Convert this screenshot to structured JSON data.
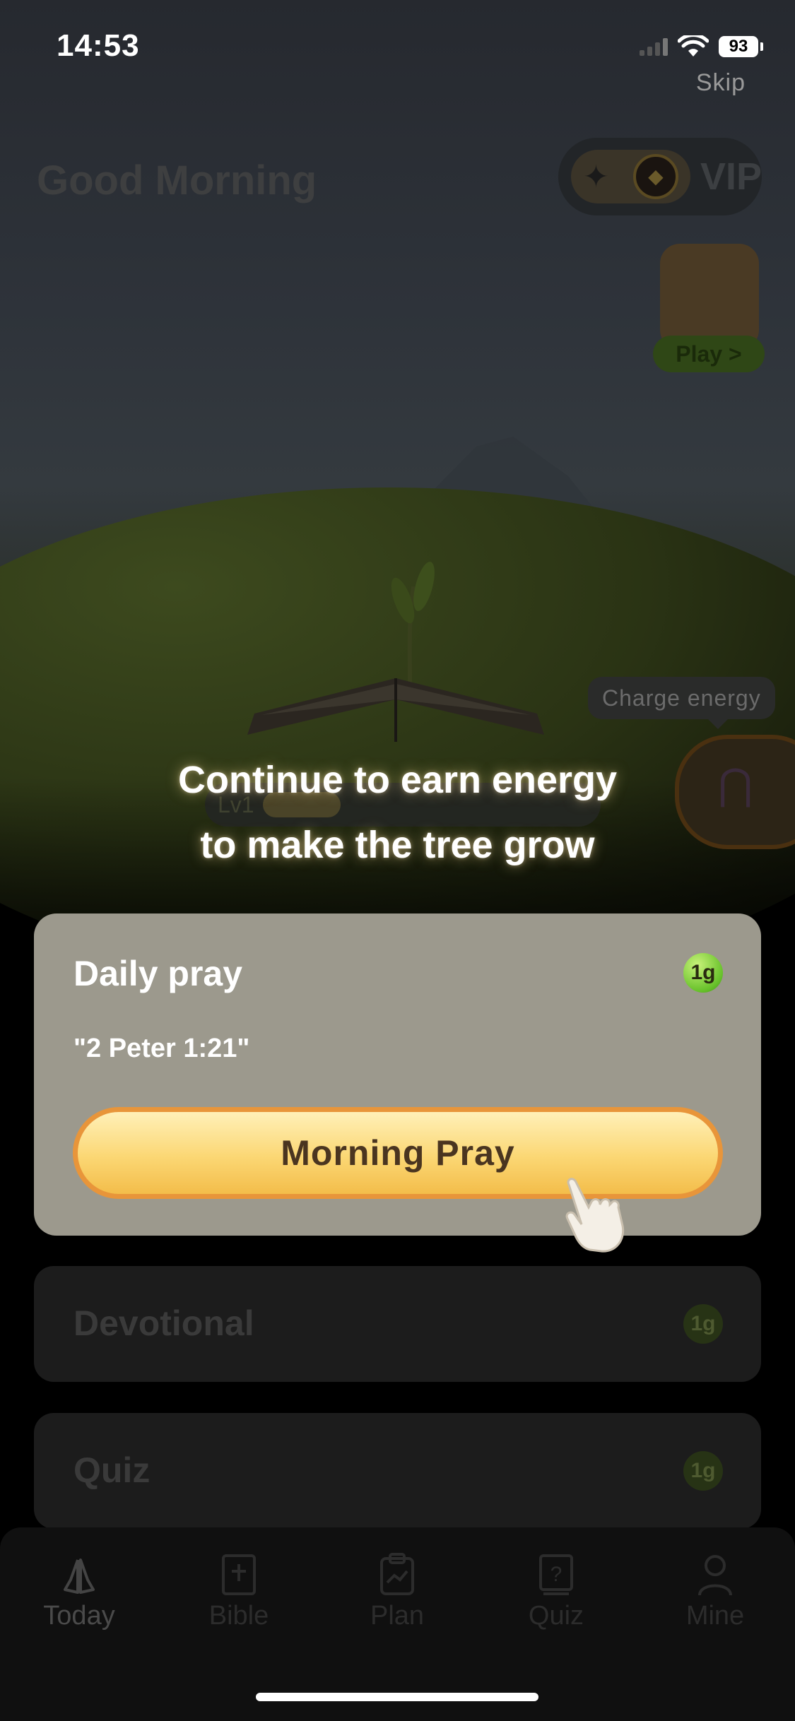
{
  "status_bar": {
    "time": "14:53",
    "battery": "93"
  },
  "skip_label": "Skip",
  "header": {
    "greeting": "Good Morning",
    "vip_label": "VIP",
    "play_label": "Play >"
  },
  "tree": {
    "level": "Lv1",
    "charge_label": "Charge energy"
  },
  "overlay": {
    "headline_line1": "Continue to earn energy",
    "headline_line2": "to make the tree grow"
  },
  "tasks": [
    {
      "title": "Daily pray",
      "reward": "1g",
      "verse": "\"2 Peter 1:21\"",
      "button": "Morning Pray"
    },
    {
      "title": "Devotional",
      "reward": "1g"
    },
    {
      "title": "Quiz",
      "reward": "1g"
    }
  ],
  "tabs": [
    {
      "label": "Today",
      "icon": "praying-hands-icon"
    },
    {
      "label": "Bible",
      "icon": "bible-icon"
    },
    {
      "label": "Plan",
      "icon": "plan-clipboard-icon"
    },
    {
      "label": "Quiz",
      "icon": "quiz-icon"
    },
    {
      "label": "Mine",
      "icon": "person-icon"
    }
  ],
  "colors": {
    "accent_button": "#fbd774",
    "button_border": "#e8953a",
    "card_highlight": "#9c998d",
    "reward_badge": "#67c12a"
  }
}
